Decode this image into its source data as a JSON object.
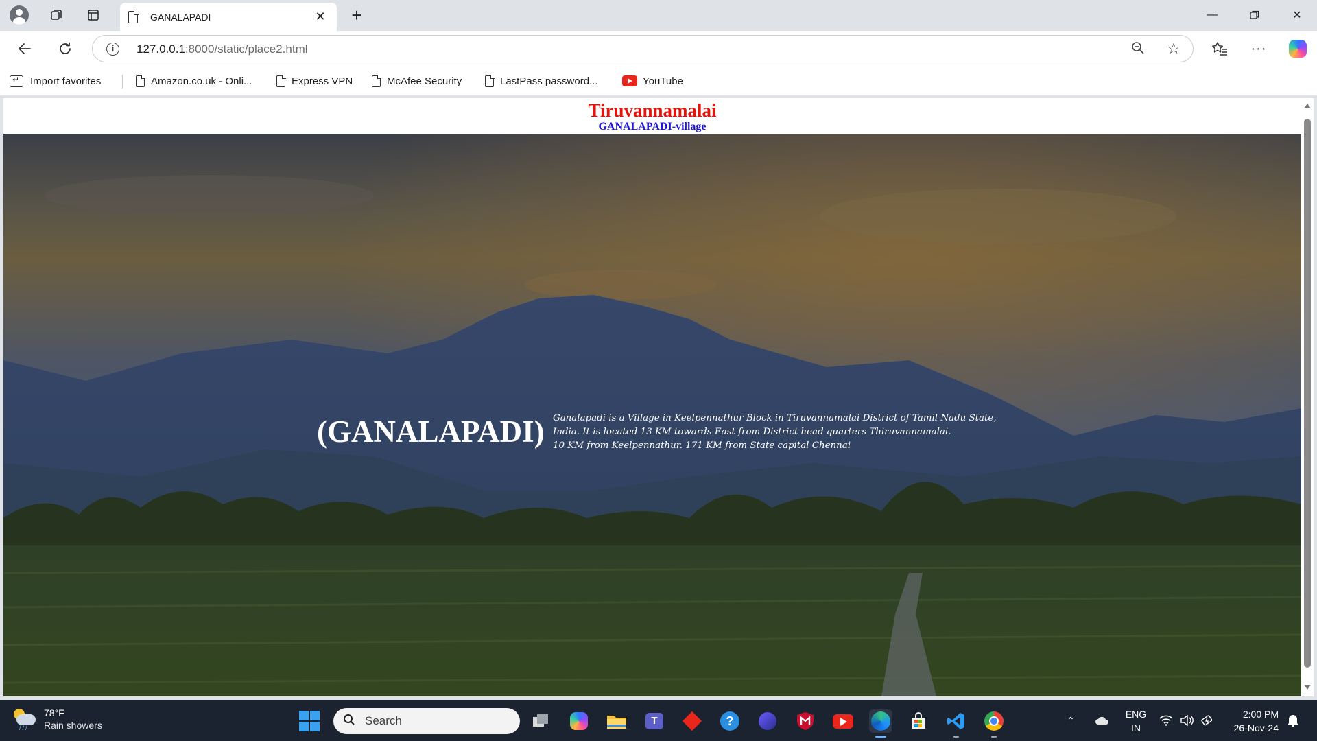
{
  "browser": {
    "tab_title": "GANALAPADI",
    "url_host": "127.0.0.1",
    "url_rest": ":8000/static/place2.html",
    "favorites": [
      {
        "label": "Import favorites"
      },
      {
        "label": "Amazon.co.uk - Onli..."
      },
      {
        "label": "Express VPN"
      },
      {
        "label": "McAfee Security"
      },
      {
        "label": "LastPass password..."
      },
      {
        "label": "YouTube"
      }
    ]
  },
  "page": {
    "title": "Tiruvannamalai",
    "subtitle": "GANALAPADI-village",
    "hero_name": "(GANALAPADI)",
    "description_lines": [
      "Ganalapadi is a Village in Keelpennathur Block in Tiruvannamalai District of Tamil Nadu State,",
      "India. It is located 13 KM towards East from District head quarters Thiruvannamalai.",
      "10 KM from Keelpennathur. 171 KM from State capital Chennai"
    ]
  },
  "taskbar": {
    "weather_temp": "78°F",
    "weather_cond": "Rain showers",
    "search_placeholder": "Search",
    "lang_primary": "ENG",
    "lang_secondary": "IN",
    "time": "2:00 PM",
    "date": "26-Nov-24"
  },
  "colors": {
    "title_red": "#e4140b",
    "subtitle_blue": "#1d16d6",
    "taskbar_bg": "#1c2330"
  }
}
